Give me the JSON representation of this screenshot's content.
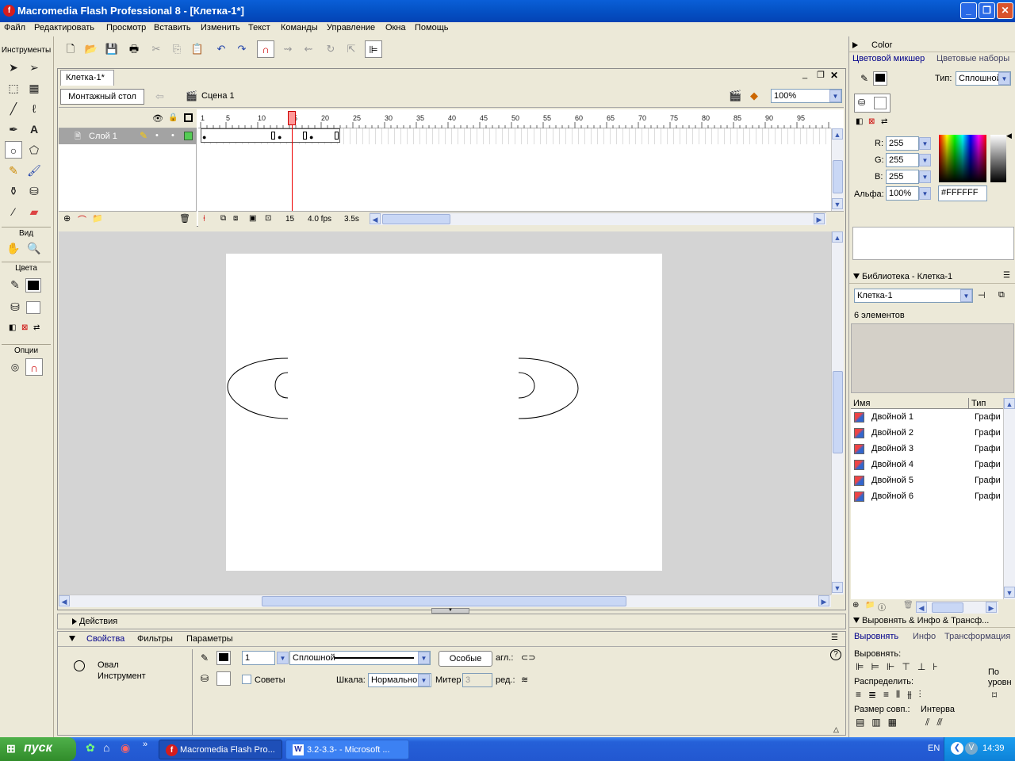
{
  "window": {
    "title": "Macromedia Flash Professional 8 - [Клетка-1*]",
    "minimize_label": "_",
    "restore_label": "❐",
    "close_label": "✕"
  },
  "menu": [
    "Файл",
    "Редактировать",
    "Просмотр",
    "Вставить",
    "Изменить",
    "Текст",
    "Команды",
    "Управление",
    "Окна",
    "Помощь"
  ],
  "tools": {
    "title": "Инструменты",
    "view_label": "Вид",
    "colors_label": "Цвета",
    "options_label": "Опции"
  },
  "document": {
    "tab": "Клетка-1*",
    "timeline_button": "Монтажный стол",
    "scene": "Сцена 1",
    "zoom": "100%"
  },
  "timeline": {
    "layer_name": "Слой 1",
    "ruler": [
      "1",
      "5",
      "10",
      "15",
      "20",
      "25",
      "30",
      "35",
      "40",
      "45",
      "50",
      "55",
      "60",
      "65",
      "70",
      "75",
      "80",
      "85",
      "90",
      "95"
    ],
    "current_frame": "15",
    "fps": "4.0 fps",
    "time": "3.5s"
  },
  "panels": {
    "actions": "Действия",
    "props_tabs": [
      "Свойства",
      "Фильтры",
      "Параметры"
    ],
    "tool_name": "Овал",
    "tool_type": "Инструмент",
    "stroke_width": "1",
    "stroke_style": "Сплошной",
    "custom_button": "Особые",
    "cap_label": "агл.:",
    "join_label": "ред.:",
    "hints_label": "Советы",
    "scale_label": "Шкала:",
    "scale_value": "Нормально",
    "miter_label": "Митер",
    "miter_value": "3",
    "help": "?"
  },
  "color_panel": {
    "title": "Color",
    "tab_mixer": "Цветовой микшер",
    "tab_swatches": "Цветовые наборы",
    "type_label": "Тип:",
    "type_value": "Сплошной",
    "r_label": "R:",
    "r": "255",
    "g_label": "G:",
    "g": "255",
    "b_label": "B:",
    "b": "255",
    "alpha_label": "Альфа:",
    "alpha": "100%",
    "hex": "#FFFFFF"
  },
  "library": {
    "title": "Библиотека - Клетка-1",
    "doc": "Клетка-1",
    "count": "6 элементов",
    "col_name": "Имя",
    "col_type": "Тип",
    "items": [
      {
        "name": "Двойной 1",
        "type": "Графи"
      },
      {
        "name": "Двойной 2",
        "type": "Графи"
      },
      {
        "name": "Двойной 3",
        "type": "Графи"
      },
      {
        "name": "Двойной 4",
        "type": "Графи"
      },
      {
        "name": "Двойной 5",
        "type": "Графи"
      },
      {
        "name": "Двойной 6",
        "type": "Графи"
      }
    ]
  },
  "align_panel": {
    "title": "Выровнять & Инфо & Трансф...",
    "tab_align": "Выровнять",
    "tab_info": "Инфо",
    "tab_transform": "Трансформация",
    "align_label": "Выровнять:",
    "distribute_label": "Распределить:",
    "match_label": "Размер совп.:",
    "space_label": "Интерва",
    "to_stage": "По",
    "to_stage2": "уровн"
  },
  "taskbar": {
    "start": "пуск",
    "task1": "Macromedia Flash Pro...",
    "task2": "3.2-3.3- - Microsoft ...",
    "lang": "EN",
    "clock": "14:39",
    "chevron": "»"
  }
}
